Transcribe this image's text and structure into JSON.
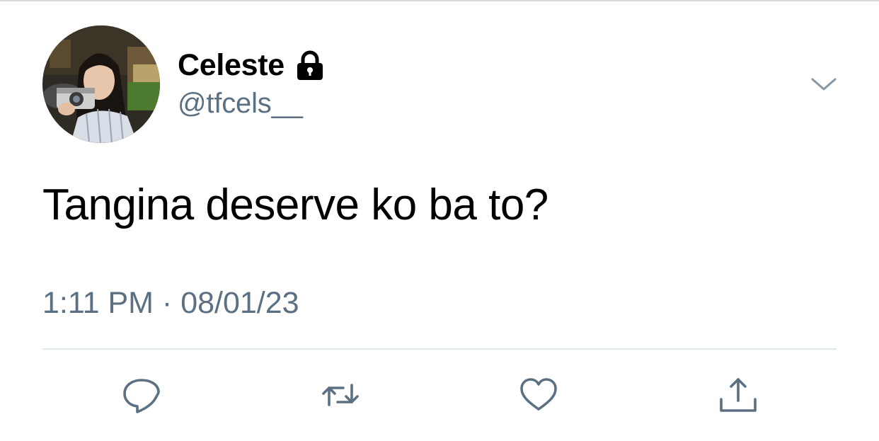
{
  "tweet": {
    "author": {
      "display_name": "Celeste",
      "handle": "@tfcels__",
      "protected_icon": "lock-icon",
      "avatar": "profile-photo"
    },
    "text": "Tangina deserve ko ba to?",
    "meta": {
      "time": "1:11 PM",
      "separator": "·",
      "date": "08/01/23"
    },
    "actions": [
      {
        "name": "reply",
        "icon": "reply-icon"
      },
      {
        "name": "retweet",
        "icon": "retweet-icon"
      },
      {
        "name": "like",
        "icon": "heart-icon"
      },
      {
        "name": "share",
        "icon": "share-icon"
      }
    ],
    "menu_icon": "chevron-down-icon"
  },
  "colors": {
    "text_primary": "#000000",
    "text_secondary": "#5b7083",
    "icon": "#5b7083",
    "divider": "#e1e8ed"
  }
}
